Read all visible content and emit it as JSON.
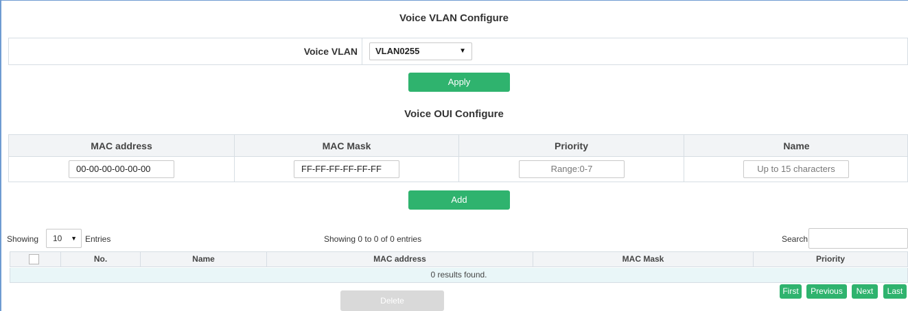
{
  "vlan_section": {
    "title": "Voice VLAN Configure",
    "label": "Voice VLAN",
    "selected": "VLAN0255",
    "apply_label": "Apply"
  },
  "oui_section": {
    "title": "Voice OUI Configure",
    "columns": [
      "MAC address",
      "MAC Mask",
      "Priority",
      "Name"
    ],
    "mac_address_value": "00-00-00-00-00-00",
    "mac_mask_value": "FF-FF-FF-FF-FF-FF",
    "priority_placeholder": "Range:0-7",
    "name_placeholder": "Up to 15 characters",
    "add_label": "Add"
  },
  "list": {
    "showing_label": "Showing",
    "entries_value": "10",
    "entries_label": "Entries",
    "summary": "Showing 0 to 0 of 0 entries",
    "search_label": "Search",
    "columns": [
      "No.",
      "Name",
      "MAC address",
      "MAC Mask",
      "Priority"
    ],
    "empty_message": "0 results found.",
    "delete_label": "Delete"
  },
  "pagination": {
    "first": "First",
    "previous": "Previous",
    "next": "Next",
    "last": "Last"
  },
  "colors": {
    "accent": "#2fb36e",
    "disabled": "#d9d9d9",
    "header_bg": "#f2f4f6",
    "row_bg": "#e9f6f8"
  }
}
